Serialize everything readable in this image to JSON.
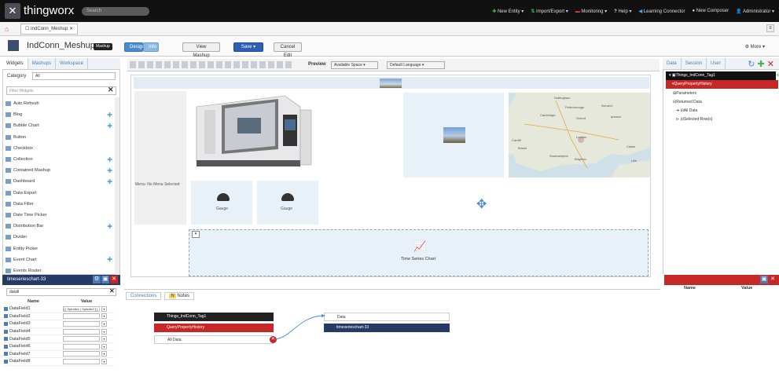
{
  "topbar": {
    "brand": "thingworx",
    "search_placeholder": "Search",
    "nav": [
      "New Entity",
      "Import/Export",
      "Monitoring",
      "Help",
      "Learning Connector",
      "New Composer",
      "Administrator"
    ]
  },
  "tab": {
    "label": "IndConn_Meshup",
    "close": "✕"
  },
  "toolbar": {
    "mashup_title": "IndConn_Meshup",
    "badge": "Mashup",
    "design": "Design",
    "info": "Info",
    "view_mashup": "View Mashup",
    "save": "Save",
    "cancel_edit": "Cancel Edit",
    "more": "More"
  },
  "left": {
    "tabs": [
      "Widgets",
      "Mashups",
      "Workspace"
    ],
    "category_label": "Category",
    "category_value": "All",
    "filter_placeholder": "Filter Widgets",
    "widgets": [
      "Auto Refresh",
      "Blog",
      "Bubble Chart",
      "Button",
      "Checkbox",
      "Collection",
      "Contained Mashup",
      "Dashboard",
      "Data Export",
      "Data Filter",
      "Date Time Picker",
      "Distribution Bar",
      "Divider",
      "Entity Picker",
      "Event Chart",
      "Events Router"
    ]
  },
  "props": {
    "title": "timeserieschart-33",
    "filter_value": "datafi",
    "col_name": "Name",
    "col_value": "Value",
    "rows": [
      "DataField1",
      "DataField2",
      "DataField3",
      "DataField4",
      "DataField5",
      "DataField6",
      "DataField7",
      "DataField8"
    ],
    "first_value": "[ [ Spindle1 | Spindle2 ] ]"
  },
  "canvas": {
    "preview": "Preview",
    "available_space": "Available Space",
    "default_language": "Default Language",
    "menu_label": "Menu: No Menu Selected",
    "gauge1": "Gauge",
    "gauge2": "Gauge",
    "ts_label": "Time Series Chart",
    "map_labels": [
      "Nottingham",
      "Peterborough",
      "Norwich",
      "Cambridge",
      "Oxford",
      "Ipswich",
      "London",
      "Cardiff",
      "Bristol",
      "Southampton",
      "Brighton",
      "Calais",
      "Lille"
    ]
  },
  "bottom": {
    "tabs": [
      "Connections",
      "Notes"
    ],
    "node_thing": "Things_IndConn_Tag1",
    "node_service": "QueryPropertyHistory",
    "node_alldata": "All Data",
    "node_data": "Data",
    "node_chart": "timeserieschart-33"
  },
  "right": {
    "tabs": [
      "Data",
      "Session",
      "User"
    ],
    "thing": "Things_IndConn_Tag1",
    "service": "QueryPropertyHistory",
    "items": [
      "Parameters",
      "Returned Data",
      "All Data",
      "Selected Row(s)"
    ],
    "col_name": "Name",
    "col_value": "Value"
  },
  "colors": {
    "accent": "#4a8ad0",
    "dark_blue": "#253a64",
    "red": "#c62828"
  }
}
